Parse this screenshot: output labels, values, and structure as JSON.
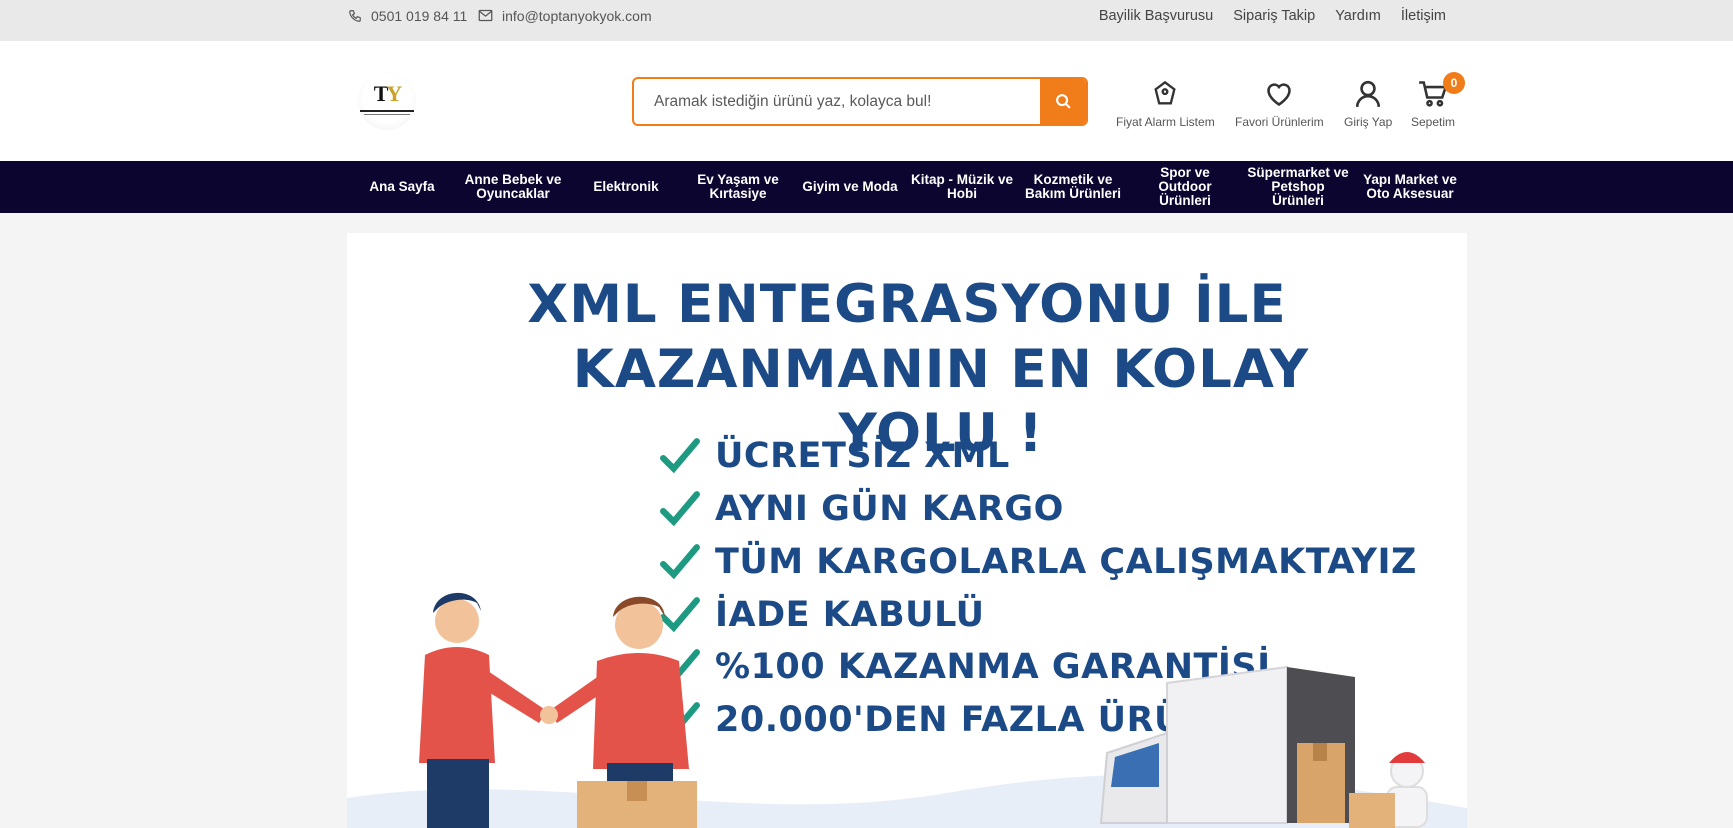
{
  "topbar": {
    "phone": "0501 019 84 11",
    "email": "info@toptanyokyok.com",
    "links": [
      "Bayilik Başvurusu",
      "Sipariş Takip",
      "Yardım",
      "İletişim"
    ]
  },
  "header": {
    "search": {
      "placeholder": "Aramak istediğin ürünü yaz, kolayca bul!"
    },
    "icons": {
      "price_alarm": "Fiyat Alarm Listem",
      "favorites": "Favori Ürünlerim",
      "login": "Giriş Yap",
      "cart": "Sepetim",
      "cart_count": "0"
    }
  },
  "nav": {
    "items": [
      "Ana Sayfa",
      "Anne Bebek ve Oyuncaklar",
      "Elektronik",
      "Ev Yaşam ve Kırtasiye",
      "Giyim ve Moda",
      "Kitap - Müzik ve Hobi",
      "Kozmetik ve Bakım Ürünleri",
      "Spor ve Outdoor Ürünleri",
      "Süpermarket ve Petshop Ürünleri",
      "Yapı Market ve Oto Aksesuar"
    ]
  },
  "banner": {
    "title_line1": "XML ENTEGRASYONU İLE",
    "title_line2": "KAZANMANIN EN KOLAY YOLU !",
    "features": [
      "ÜCRETSİZ XML",
      "AYNI GÜN KARGO",
      "TÜM KARGOLARLA ÇALIŞMAKTAYIZ",
      "İADE KABULÜ",
      "%100 KAZANMA GARANTİSİ",
      "20.000'DEN FAZLA ÜRÜN"
    ]
  },
  "colors": {
    "accent": "#f07c1a",
    "nav_bg": "#0b0530",
    "banner_text": "#1c4a86",
    "check": "#1f9a82"
  }
}
